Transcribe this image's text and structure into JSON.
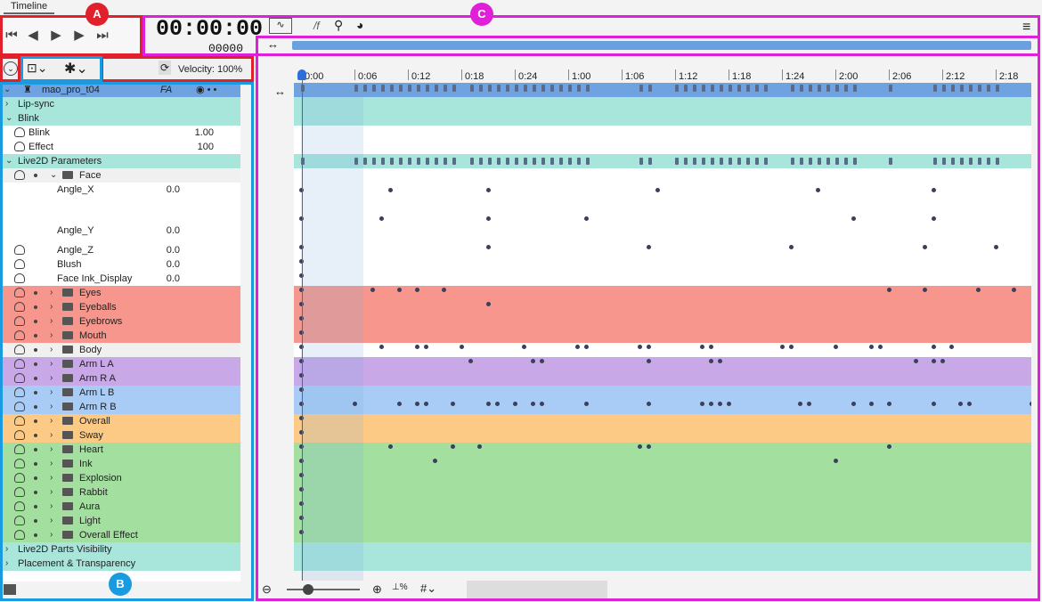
{
  "window": {
    "tab_label": "Timeline"
  },
  "transport": {
    "timecode": "00:00:00",
    "frame": "00000",
    "velocity_label": "Velocity:",
    "velocity_value": "100%"
  },
  "timeline": {
    "ruler": [
      "0:00",
      "0:06",
      "0:12",
      "0:18",
      "0:24",
      "1:00",
      "1:06",
      "1:12",
      "1:18",
      "1:24",
      "2:00",
      "2:06",
      "2:12",
      "2:18"
    ],
    "fps_label": "/f"
  },
  "track_root": {
    "label": "mao_pro_t04",
    "flags": "FA"
  },
  "groups": [
    {
      "label": "Lip-sync"
    },
    {
      "label": "Blink"
    },
    {
      "label": "Blink",
      "value": "1.00"
    },
    {
      "label": "Effect",
      "value": "100"
    },
    {
      "label": "Live2D Parameters"
    },
    {
      "label": "Face"
    },
    {
      "label": "Angle_X",
      "value": "0.0"
    },
    {
      "label": "Angle_Y",
      "value": "0.0"
    },
    {
      "label": "Angle_Z",
      "value": "0.0"
    },
    {
      "label": "Blush",
      "value": "0.0"
    },
    {
      "label": "Face Ink_Display",
      "value": "0.0"
    },
    {
      "label": "Eyes"
    },
    {
      "label": "Eyeballs"
    },
    {
      "label": "Eyebrows"
    },
    {
      "label": "Mouth"
    },
    {
      "label": "Body"
    },
    {
      "label": "Arm L A"
    },
    {
      "label": "Arm R A"
    },
    {
      "label": "Arm L B"
    },
    {
      "label": "Arm R B"
    },
    {
      "label": "Overall"
    },
    {
      "label": "Sway"
    },
    {
      "label": "Heart"
    },
    {
      "label": "Ink"
    },
    {
      "label": "Explosion"
    },
    {
      "label": "Rabbit"
    },
    {
      "label": "Aura"
    },
    {
      "label": "Light"
    },
    {
      "label": "Overall Effect"
    },
    {
      "label": "Live2D Parts Visibility"
    },
    {
      "label": "Placement & Transparency"
    }
  ],
  "annotations": {
    "a": "A",
    "b": "B",
    "c": "C"
  },
  "colors": {
    "teal": "#a8e6dc",
    "red": "#f7968c",
    "purple": "#c9a8e8",
    "blue": "#a8ccf5",
    "orange": "#fdca85",
    "green": "#a3e0a0",
    "accent": "#2a6fdb"
  }
}
